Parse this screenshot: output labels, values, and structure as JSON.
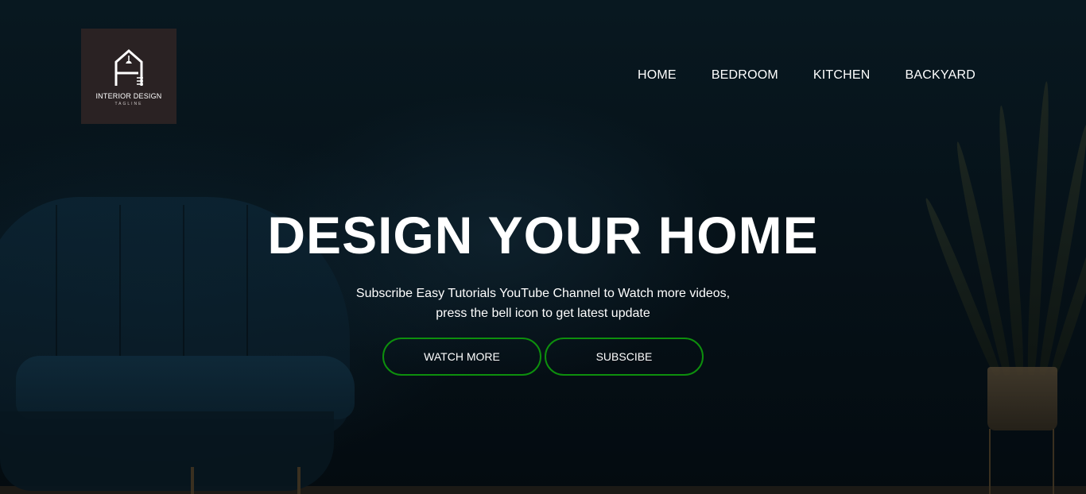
{
  "logo": {
    "name": "INTERIOR DESIGN",
    "tagline": "TAGLINE"
  },
  "nav": {
    "items": [
      "HOME",
      "BEDROOM",
      "KITCHEN",
      "BACKYARD"
    ]
  },
  "hero": {
    "title": "DESIGN YOUR HOME",
    "subtitle_line1": "Subscribe Easy Tutorials YouTube Channel to Watch more videos,",
    "subtitle_line2": "press the bell icon to get latest update",
    "buttons": {
      "primary": "WATCH MORE",
      "secondary": "SUBSCIBE"
    }
  },
  "colors": {
    "button_border": "#0d8f0d",
    "logo_bg": "#2a2223",
    "background": "#07121a"
  }
}
